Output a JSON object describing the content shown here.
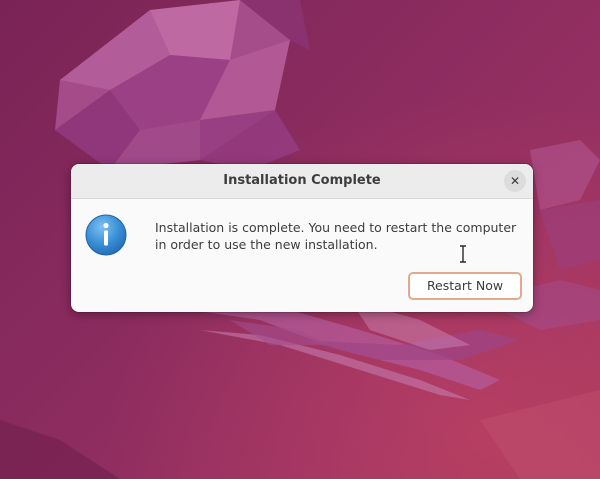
{
  "desktop": {
    "background_color": "#8a2d5e"
  },
  "dialog": {
    "title": "Installation Complete",
    "close_label": "✕",
    "icon": "info-icon",
    "message": "Installation is complete. You need to restart the computer in order to use the new installation.",
    "restart_button_label": "Restart Now",
    "accent_color": "#e3a98f"
  },
  "cursor": {
    "type": "text-cursor"
  }
}
